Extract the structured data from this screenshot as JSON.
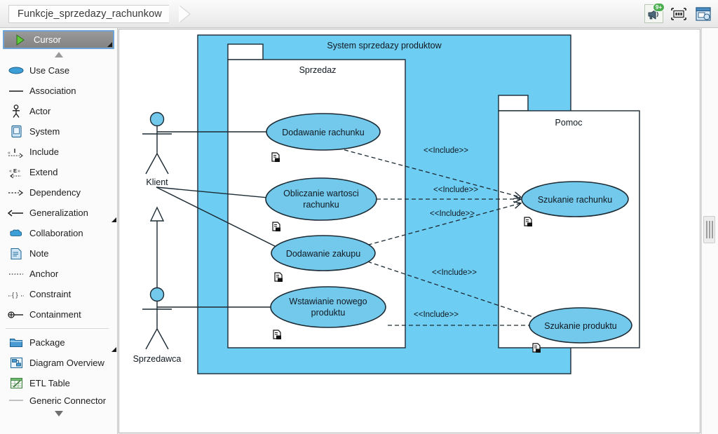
{
  "window": {
    "breadcrumb": "Funkcje_sprzedazy_rachunkow"
  },
  "toolbar": {
    "icons": [
      {
        "name": "announcement-megaphone-icon",
        "badge": "9+"
      },
      {
        "name": "resize-diagram-icon",
        "badge": ""
      },
      {
        "name": "diagram-layers-icon",
        "badge": ""
      }
    ]
  },
  "palette": {
    "items": [
      {
        "label": "Cursor",
        "icon": "cursor-arrow-icon",
        "selected": true,
        "has_corner": true
      },
      {
        "label": "Use Case",
        "icon": "use-case-ellipse-icon",
        "selected": false,
        "has_corner": false
      },
      {
        "label": "Association",
        "icon": "association-line-icon",
        "selected": false,
        "has_corner": false
      },
      {
        "label": "Actor",
        "icon": "actor-stickman-icon",
        "selected": false,
        "has_corner": false
      },
      {
        "label": "System",
        "icon": "system-box-icon",
        "selected": false,
        "has_corner": false
      },
      {
        "label": "Include",
        "icon": "include-arrow-icon",
        "selected": false,
        "has_corner": false
      },
      {
        "label": "Extend",
        "icon": "extend-arrow-icon",
        "selected": false,
        "has_corner": false
      },
      {
        "label": "Dependency",
        "icon": "dependency-arrow-icon",
        "selected": false,
        "has_corner": false
      },
      {
        "label": "Generalization",
        "icon": "generalization-arrow-icon",
        "selected": false,
        "has_corner": true
      },
      {
        "label": "Collaboration",
        "icon": "collaboration-cloud-icon",
        "selected": false,
        "has_corner": false
      },
      {
        "label": "Note",
        "icon": "note-page-icon",
        "selected": false,
        "has_corner": false
      },
      {
        "label": "Anchor",
        "icon": "anchor-dotted-line-icon",
        "selected": false,
        "has_corner": false
      },
      {
        "label": "Constraint",
        "icon": "constraint-braces-icon",
        "selected": false,
        "has_corner": false
      },
      {
        "label": "Containment",
        "icon": "containment-circle-plus-icon",
        "selected": false,
        "has_corner": false
      }
    ],
    "items2": [
      {
        "label": "Package",
        "icon": "package-folder-icon",
        "has_corner": true
      },
      {
        "label": "Diagram Overview",
        "icon": "diagram-overview-icon",
        "has_corner": false
      },
      {
        "label": "ETL Table",
        "icon": "etl-table-icon",
        "has_corner": false
      },
      {
        "label": "Generic Connector",
        "icon": "generic-connector-icon",
        "has_corner": false
      }
    ]
  },
  "diagram": {
    "system_title": "System sprzedazy produktow",
    "packages": [
      {
        "name": "Sprzedaz"
      },
      {
        "name": "Pomoc"
      }
    ],
    "actors": [
      {
        "name": "Klient"
      },
      {
        "name": "Sprzedawca"
      }
    ],
    "use_cases": [
      {
        "name": "Dodawanie rachunku"
      },
      {
        "name": "Obliczanie wartosci rachunku"
      },
      {
        "name": "Dodawanie zakupu"
      },
      {
        "name": "Wstawianie nowego produktu"
      },
      {
        "name": "Szukanie rachunku"
      },
      {
        "name": "Szukanie produktu"
      }
    ],
    "include_labels": [
      {
        "text": "<<Include>>"
      },
      {
        "text": "<<Include>>"
      },
      {
        "text": "<<Include>>"
      },
      {
        "text": "<<Include>>"
      },
      {
        "text": "<<Include>>"
      }
    ],
    "colors": {
      "system_fill": "#6ECDF2",
      "usecase_fill": "#73C9EC",
      "package_fill": "#FFFFFF",
      "stroke": "#1b2a33"
    }
  }
}
